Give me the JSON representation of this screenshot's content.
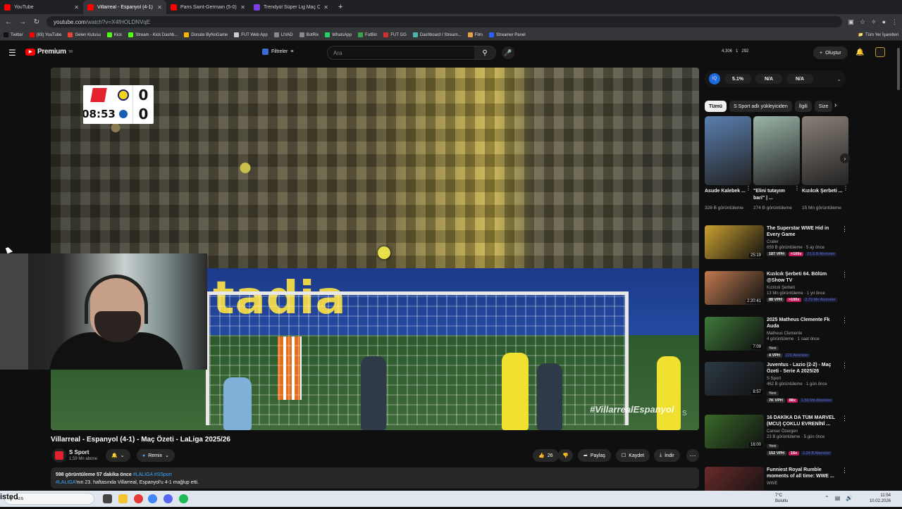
{
  "browser": {
    "tabs": [
      {
        "label": "YouTube",
        "color": "#ff0000",
        "active": false
      },
      {
        "label": "Villarreal - Espanyol (4-1) ...",
        "color": "#ff0000",
        "active": true
      },
      {
        "label": "Paris Saint-Germain (5-0) Marse",
        "color": "#ff0000",
        "active": false
      },
      {
        "label": "Trendyol Süper Lig Maç Özetle",
        "color": "#7b3fe4",
        "active": false
      }
    ],
    "new_tab": "+",
    "url_host": "youtube.com",
    "url_path": "/watch?v=X4fHOLDNVqE",
    "bookmarks": [
      {
        "label": "Twitter",
        "color": "#111111"
      },
      {
        "label": "(83) YouTube",
        "color": "#ff0000"
      },
      {
        "label": "Gelen Kutusu",
        "color": "#ea4335"
      },
      {
        "label": "Kick",
        "color": "#53fc18"
      },
      {
        "label": "Stream - Kick Dashb...",
        "color": "#53fc18"
      },
      {
        "label": "Donate ByNoGame",
        "color": "#f4b400"
      },
      {
        "label": "FUT Web App",
        "color": "#cccccc"
      },
      {
        "label": "LIVAD",
        "color": "#888888"
      },
      {
        "label": "BotRix",
        "color": "#888888"
      },
      {
        "label": "WhatsApp",
        "color": "#25d366"
      },
      {
        "label": "FutBin",
        "color": "#3fa34d"
      },
      {
        "label": "FUT GG",
        "color": "#d32f2f"
      },
      {
        "label": "Dashboard / Stream...",
        "color": "#4db6ac"
      },
      {
        "label": "Film",
        "color": "#e8a045"
      },
      {
        "label": "Streamer Panel",
        "color": "#2962ff"
      }
    ],
    "bookmarks_right": "Tüm Yer İşaretleri"
  },
  "header": {
    "logo": "Premium",
    "logo_sup": "TR",
    "filters_label": "Filtreler",
    "search_placeholder": "Ara",
    "stats": [
      "4,306",
      "1",
      "292"
    ],
    "create_label": "Oluştur"
  },
  "video": {
    "league_score_home": "0",
    "league_score_away": "0",
    "clock": "08:53",
    "board_text": "tadia",
    "hashtag": "#VillarrealEspanyol",
    "watermark": "S"
  },
  "info": {
    "title": "Villarreal - Espanyol (4-1) - Maç Özeti - LaLiga 2025/26",
    "channel": "S Sport",
    "subs": "1,59 Mn abone",
    "remix": "Remix",
    "likes": "26",
    "share": "Paylaş",
    "save": "Kaydet",
    "download": "İndir",
    "desc_views": "598 görüntüleme  57 dakika önce",
    "desc_tags": "#LALIGA #SSport",
    "desc_line2_tag": "#LALIGA",
    "desc_line2": "'nın 23. haftasında Villarreal, Espanyol'u 4-1 mağlup etti."
  },
  "sidebar": {
    "ext_values": [
      "5.1%",
      "N/A",
      "N/A"
    ],
    "chips": [
      "Tümü",
      "S Sport adlı yükleyiciden",
      "İlgili",
      "Size"
    ],
    "shorts": [
      {
        "title": "Asude Kalebek ...",
        "views": "328 B görüntüleme",
        "color": "#5a7fb0"
      },
      {
        "title": "\"Elini tutayım bari\" | ...",
        "views": "274 B görüntüleme",
        "color": "#9bb5a8"
      },
      {
        "title": "Kızılcık Şerbeti ...",
        "views": "15 Mn görüntüleme",
        "color": "#8a8078"
      }
    ],
    "recs": [
      {
        "title": "The Superstar WWE Hid in Every Game",
        "channel": "Crater",
        "meta": "659 B görüntüleme · 5 ay önce",
        "dur": "25:19",
        "vph": "187 VPH",
        "mult": ">100x",
        "subs": "21.5 B Aboneler",
        "color": "#caa030",
        "yeni": ""
      },
      {
        "title": "Kızılcık Şerbeti 64. Bölüm @Show TV",
        "channel": "Kızılcık Şerbeti",
        "meta": "13 Mn görüntüleme · 1 yıl önce",
        "dur": "2:20:41",
        "vph": "88 VPH",
        "mult": ">100x",
        "subs": "2,79 Mn Aboneler",
        "color": "#c07a50",
        "yeni": ""
      },
      {
        "title": "2025 Matheus Clemente Fk Auda",
        "channel": "Matheus Clemente",
        "meta": "4 görüntüleme · 1 saat önce",
        "dur": "7:09",
        "vph": "4 VPH",
        "mult": "",
        "subs": "221 Aboneler",
        "color": "#3f7a3a",
        "yeni": "Yeni"
      },
      {
        "title": "Juventus - Lazio (2-2) - Maç Özeti - Serie A 2025/26",
        "channel": "S Sport",
        "meta": "462 B görüntüleme · 1 gün önce",
        "dur": "8:57",
        "vph": "7K VPH",
        "mult": "88x",
        "subs": "1,59 Mn Aboneler",
        "color": "#2c3a44",
        "yeni": "Yeni"
      },
      {
        "title": "16 DAKİKA DA TÜM MARVEL (MCU) ÇOKLU EVRENİNİ ...",
        "channel": "Canser Özergen",
        "meta": "23 B görüntüleme · 5 gün önce",
        "dur": "16:00",
        "vph": "152 VPH",
        "mult": "16x",
        "subs": "1,24 B Aboneler",
        "color": "#3a6b2a",
        "yeni": "Yeni"
      },
      {
        "title": "Funniest Royal Rumble moments of all time: WWE ...",
        "channel": "WWE",
        "meta": "",
        "dur": "",
        "vph": "",
        "mult": "",
        "subs": "",
        "color": "#6a2a2a",
        "yeni": ""
      }
    ]
  },
  "taskbar": {
    "search": "Ara",
    "weather_temp": "7°C",
    "weather_text": "Bulutlu",
    "time": "11:54",
    "date": "10.02.2026",
    "overlay_text": "isted"
  }
}
